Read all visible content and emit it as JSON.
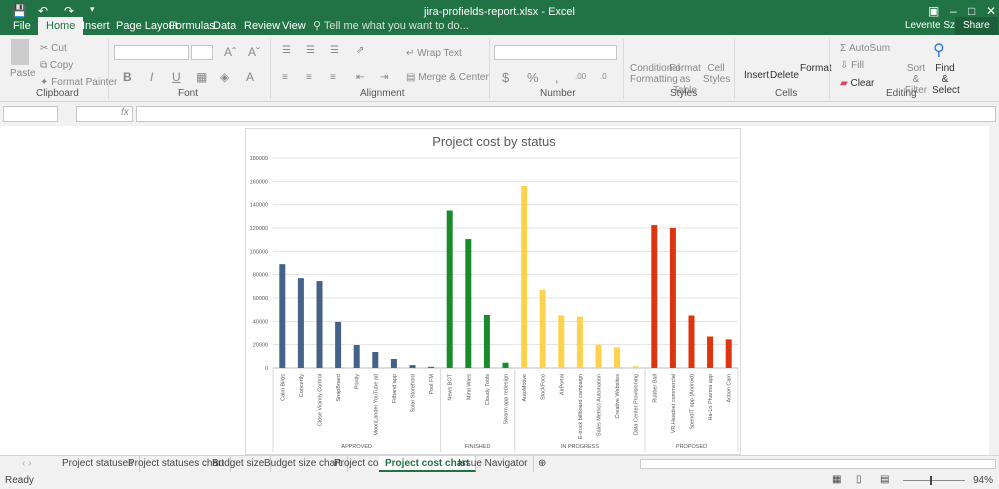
{
  "window": {
    "title": "jira-profields-report.xlsx - Excel",
    "user": "Levente Szabo",
    "share": "Share"
  },
  "menu_tabs": [
    "File",
    "Home",
    "Insert",
    "Page Layout",
    "Formulas",
    "Data",
    "Review",
    "View"
  ],
  "tell_me": "Tell me what you want to do...",
  "ribbon": {
    "clipboard": {
      "paste": "Paste",
      "cut": "Cut",
      "copy": "Copy",
      "format_painter": "Format Painter",
      "label": "Clipboard"
    },
    "font": {
      "label": "Font",
      "bold": "B",
      "italic": "I",
      "underline": "U"
    },
    "alignment": {
      "wrap": "Wrap Text",
      "merge": "Merge & Center",
      "label": "Alignment"
    },
    "number": {
      "label": "Number",
      "currency": "$",
      "percent": "%",
      "comma": ","
    },
    "styles": {
      "cond": "Conditional Formatting",
      "table": "Format as Table",
      "cell": "Cell Styles",
      "label": "Styles"
    },
    "cells": {
      "insert": "Insert",
      "delete": "Delete",
      "format": "Format",
      "label": "Cells"
    },
    "editing": {
      "autosum": "AutoSum",
      "fill": "Fill",
      "clear": "Clear",
      "sort": "Sort & Filter",
      "find": "Find & Select",
      "label": "Editing"
    }
  },
  "formula_bar": {
    "fx": "fx",
    "name_box": "",
    "value": ""
  },
  "sheet_tabs": [
    "Project statuses",
    "Project statuses chart",
    "Budget size",
    "Budget size chart",
    "Project cost",
    "Project cost chart",
    "Issue Navigator"
  ],
  "active_sheet": "Project cost chart",
  "status": {
    "ready": "Ready",
    "zoom": "94%"
  },
  "chart_data": {
    "type": "bar",
    "title": "Project cost by status",
    "ylim": [
      0,
      180000
    ],
    "yticks": [
      0,
      20000,
      40000,
      60000,
      80000,
      100000,
      120000,
      140000,
      160000,
      180000
    ],
    "grid": true,
    "groups": [
      {
        "name": "APPROVED",
        "color": "#44618a",
        "categories": [
          "Calm Birds",
          "Concertly",
          "Close Vicinity Control",
          "SnapBoard",
          "Printly",
          "MoonLander YouTube ad",
          "Fitband app",
          "Solar Storefront",
          "Pool FM"
        ],
        "values": [
          89000,
          77000,
          74500,
          39500,
          19700,
          13700,
          7700,
          2500,
          1000
        ]
      },
      {
        "name": "FINISHED",
        "color": "#1b8a2c",
        "categories": [
          "News BOT",
          "Mind Wars",
          "Cloudy Tools",
          "Swarm app redesign"
        ],
        "values": [
          135000,
          110500,
          45500,
          4500
        ]
      },
      {
        "name": "IN PROGRESS",
        "color": "#ffd24d",
        "categories": [
          "AutoMotive",
          "StockFoco",
          "AirPortal",
          "E-truck billboard campaign",
          "Sales Metrics Automation",
          "Creative Websites",
          "Data Center Provisioning"
        ],
        "values": [
          156000,
          67000,
          45000,
          44000,
          20000,
          17500,
          1500
        ]
      },
      {
        "name": "PROPOSED",
        "color": "#dd3510",
        "categories": [
          "Rubber Ball",
          "VR Headset commercial",
          "SpendIT app (Android)",
          "Ha-Lo Pharma app",
          "Action Cam"
        ],
        "values": [
          122500,
          120000,
          45000,
          27000,
          24500
        ]
      }
    ]
  }
}
